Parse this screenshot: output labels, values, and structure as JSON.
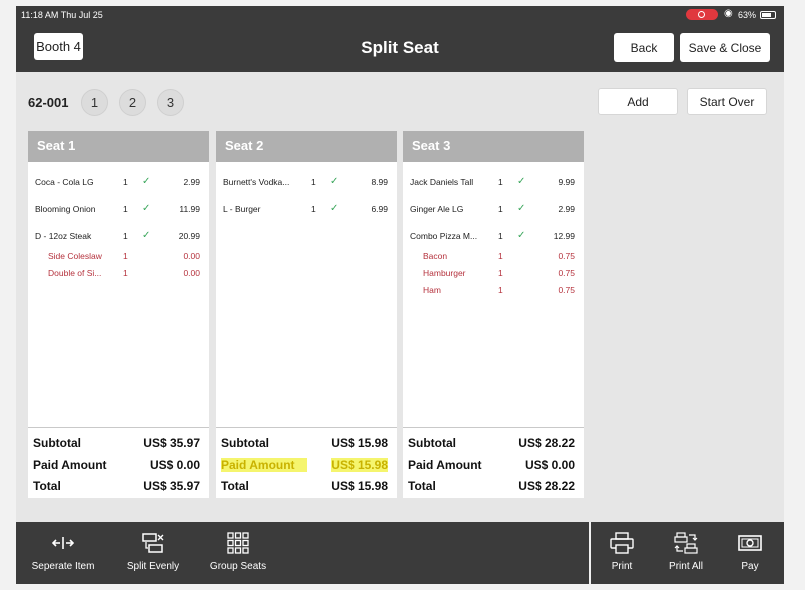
{
  "status": {
    "time": "11:18 AM   Thu Jul 25",
    "battery": "63%"
  },
  "header": {
    "table": "Booth 4",
    "title": "Split Seat",
    "back": "Back",
    "save_close": "Save & Close"
  },
  "order": {
    "id": "62-001",
    "seat_tabs": [
      "1",
      "2",
      "3"
    ],
    "add": "Add",
    "start_over": "Start Over"
  },
  "seats": [
    {
      "name": "Seat 1",
      "items": [
        {
          "name": "Coca - Cola LG",
          "qty": "1",
          "price": "2.99"
        },
        {
          "name": "Blooming Onion",
          "qty": "1",
          "price": "11.99"
        },
        {
          "name": "D - 12oz Steak",
          "qty": "1",
          "price": "20.99"
        },
        {
          "name": "Side Coleslaw",
          "qty": "1",
          "price": "0.00"
        },
        {
          "name": "Double of Si...",
          "qty": "1",
          "price": "0.00"
        }
      ],
      "subtotal": "US$ 35.97",
      "paid": "US$ 0.00",
      "total": "US$ 35.97"
    },
    {
      "name": "Seat 2",
      "items": [
        {
          "name": "Burnett's Vodka...",
          "qty": "1",
          "price": "8.99"
        },
        {
          "name": "L - Burger",
          "qty": "1",
          "price": "6.99"
        }
      ],
      "subtotal": "US$ 15.98",
      "paid": "US$ 15.98",
      "total": "US$ 15.98"
    },
    {
      "name": "Seat 3",
      "items": [
        {
          "name": "Jack Daniels Tall",
          "qty": "1",
          "price": "9.99"
        },
        {
          "name": "Ginger Ale LG",
          "qty": "1",
          "price": "2.99"
        },
        {
          "name": "Combo Pizza M...",
          "qty": "1",
          "price": "12.99"
        },
        {
          "name": "Bacon",
          "qty": "1",
          "price": "0.75"
        },
        {
          "name": "Hamburger",
          "qty": "1",
          "price": "0.75"
        },
        {
          "name": "Ham",
          "qty": "1",
          "price": "0.75"
        }
      ],
      "subtotal": "US$ 28.22",
      "paid": "US$ 0.00",
      "total": "US$ 28.22"
    }
  ],
  "labels": {
    "subtotal": "Subtotal",
    "paid": "Paid Amount",
    "total": "Total"
  },
  "toolbar": {
    "separate": "Seperate Item",
    "split_evenly": "Split Evenly",
    "group_seats": "Group Seats",
    "print": "Print",
    "print_all": "Print All",
    "pay": "Pay"
  },
  "colors": {
    "dark_bar": "#3b3b3b",
    "seat_header": "#b0b0b0",
    "check": "#3aa65b",
    "modifier": "#b5323d",
    "highlight": "#f5f56e"
  }
}
